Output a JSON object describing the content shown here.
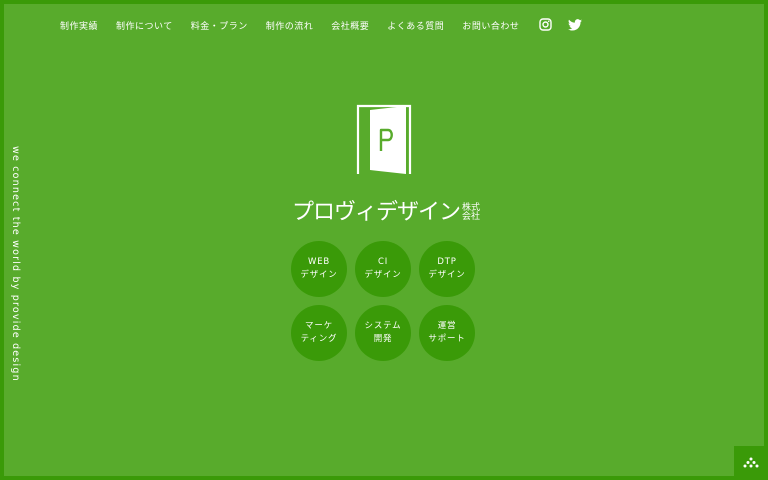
{
  "nav": {
    "items": [
      {
        "label": "制作実績"
      },
      {
        "label": "制作について"
      },
      {
        "label": "料金・プラン"
      },
      {
        "label": "制作の流れ"
      },
      {
        "label": "会社概要"
      },
      {
        "label": "よくある質問"
      },
      {
        "label": "お問い合わせ"
      }
    ],
    "social": [
      {
        "icon": "instagram-icon"
      },
      {
        "icon": "twitter-icon"
      }
    ]
  },
  "tagline": "we connect the world by provide design",
  "logo": {
    "door_letter": "P",
    "name": "プロヴィデザイン",
    "suffix_line1": "株式",
    "suffix_line2": "会社"
  },
  "services": [
    {
      "line1": "WEB",
      "line2": "デザイン",
      "name": "service-web-design"
    },
    {
      "line1": "CI",
      "line2": "デザイン",
      "name": "service-ci-design"
    },
    {
      "line1": "DTP",
      "line2": "デザイン",
      "name": "service-dtp-design"
    },
    {
      "line1": "マーケ",
      "line2": "ティング",
      "name": "service-marketing"
    },
    {
      "line1": "システム",
      "line2": "開発",
      "name": "service-system-dev"
    },
    {
      "line1": "運営",
      "line2": "サポート",
      "name": "service-operation-support"
    }
  ],
  "colors": {
    "background": "#58ab2c",
    "accent": "#3a9a08",
    "text": "#ffffff"
  }
}
